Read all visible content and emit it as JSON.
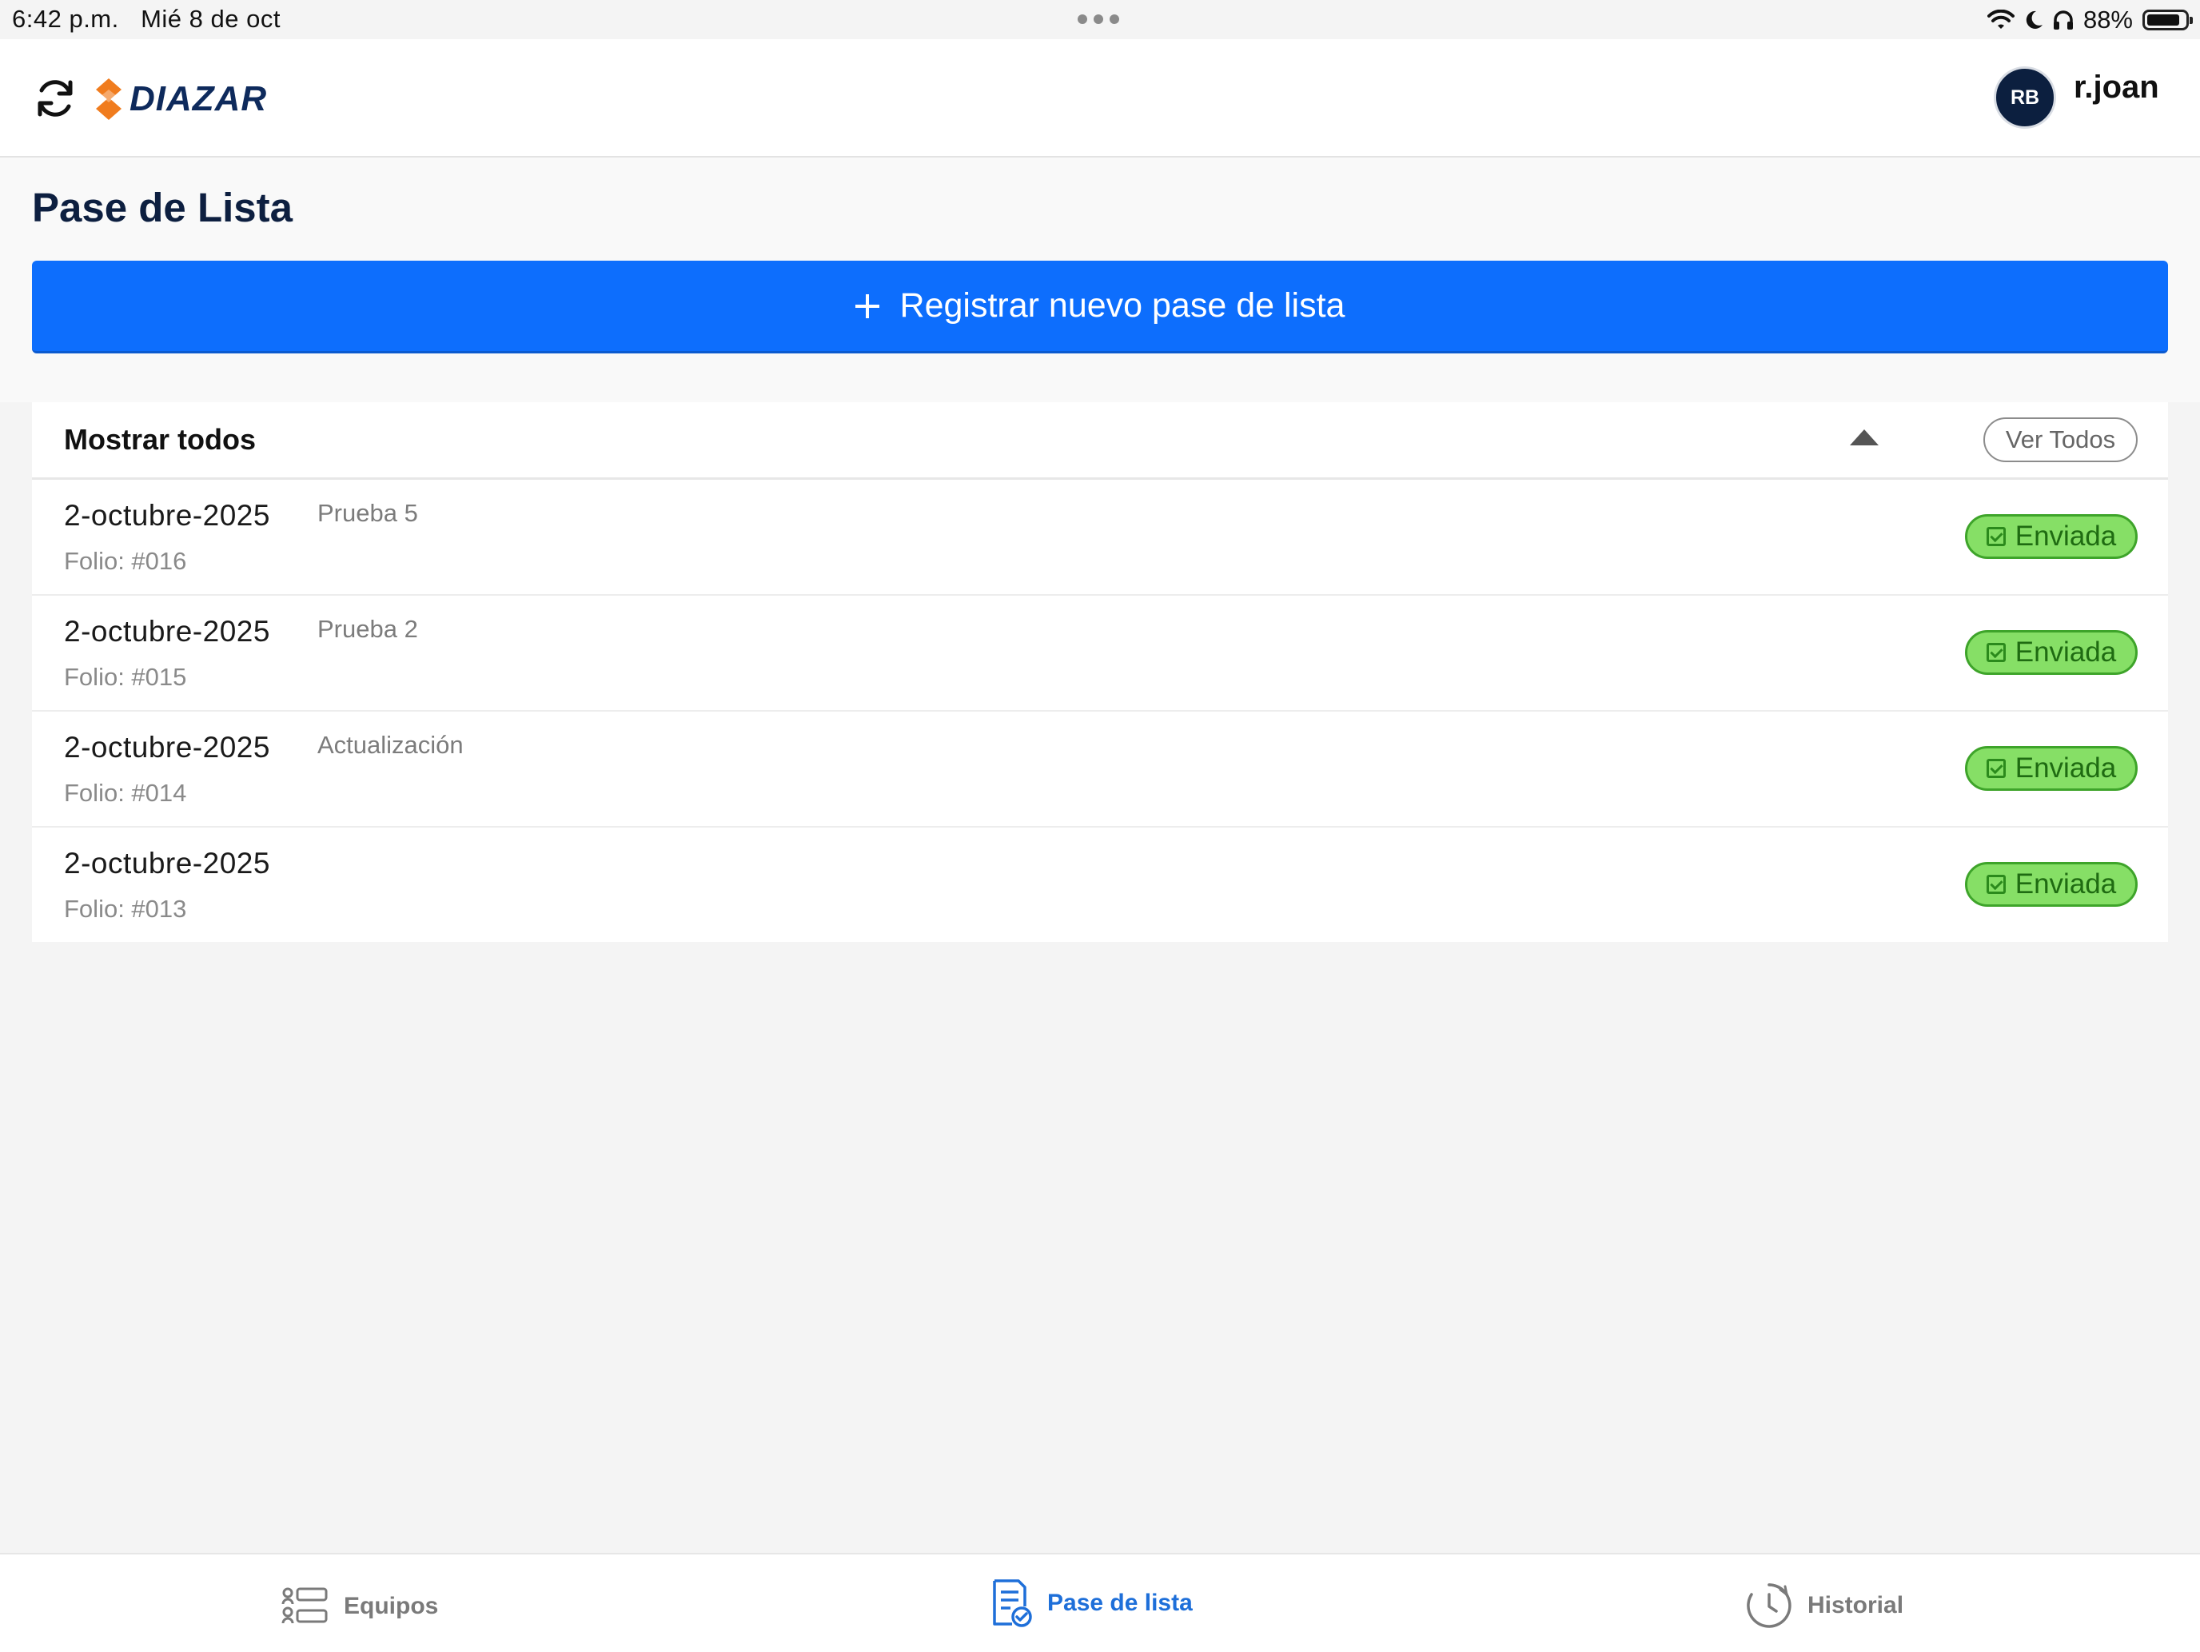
{
  "status_bar": {
    "time": "6:42 p.m.",
    "date": "Mié 8 de oct",
    "battery_percent": "88%",
    "battery_level": 0.88
  },
  "header": {
    "logo_text": "DIAZAR",
    "avatar_initials": "RB",
    "username": "r.joan"
  },
  "page": {
    "title": "Pase de Lista",
    "new_button_label": "Registrar nuevo pase de lista"
  },
  "list": {
    "header_title": "Mostrar todos",
    "view_all_label": "Ver Todos",
    "items": [
      {
        "date": "2-octubre-2025",
        "description": "Prueba 5",
        "folio": "Folio: #016",
        "status": "Enviada"
      },
      {
        "date": "2-octubre-2025",
        "description": "Prueba 2",
        "folio": "Folio: #015",
        "status": "Enviada"
      },
      {
        "date": "2-octubre-2025",
        "description": "Actualización",
        "folio": "Folio: #014",
        "status": "Enviada"
      },
      {
        "date": "2-octubre-2025",
        "description": "",
        "folio": "Folio: #013",
        "status": "Enviada"
      }
    ]
  },
  "tabs": [
    {
      "label": "Equipos",
      "icon": "equipment-list-icon",
      "active": false
    },
    {
      "label": "Pase de lista",
      "icon": "checklist-document-icon",
      "active": true
    },
    {
      "label": "Historial",
      "icon": "history-clock-icon",
      "active": false
    }
  ],
  "colors": {
    "primary": "#0d6efd",
    "active_tab": "#1e6fd9",
    "status_sent_bg": "#86df66",
    "status_sent_border": "#3ea42a",
    "brand_navy": "#0e2a5c",
    "brand_orange": "#f07c1e"
  }
}
